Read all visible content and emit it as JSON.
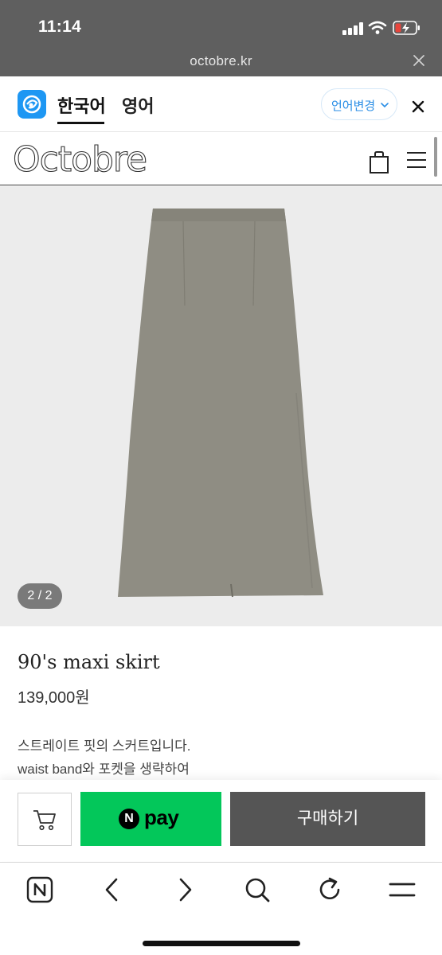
{
  "status_bar": {
    "time": "11:14"
  },
  "browser": {
    "url": "octobre.kr"
  },
  "translate_bar": {
    "lang_korean": "한국어",
    "lang_english": "영어",
    "change_language": "언어변경"
  },
  "site": {
    "logo_text": "Octobre"
  },
  "product": {
    "slide_counter": "2 / 2",
    "name": "90's maxi skirt",
    "price": "139,000원",
    "description_line1": "스트레이트 핏의 스커트입니다.",
    "description_line2": "waist band와 포켓을 생략하여"
  },
  "purchase": {
    "npay_badge": "N",
    "npay_label": "pay",
    "buy_label": "구매하기"
  },
  "colors": {
    "npay_green": "#03c75a",
    "buy_button": "#555555",
    "skirt": "#8f8d83",
    "papago_blue": "#1e97f3"
  },
  "icons": [
    "wifi-icon",
    "battery-icon",
    "close-icon",
    "chevron-down-icon",
    "shopping-bag-icon",
    "hamburger-menu-icon",
    "cart-icon",
    "naver-home-icon",
    "back-icon",
    "forward-icon",
    "search-icon",
    "refresh-icon",
    "menu-icon"
  ]
}
